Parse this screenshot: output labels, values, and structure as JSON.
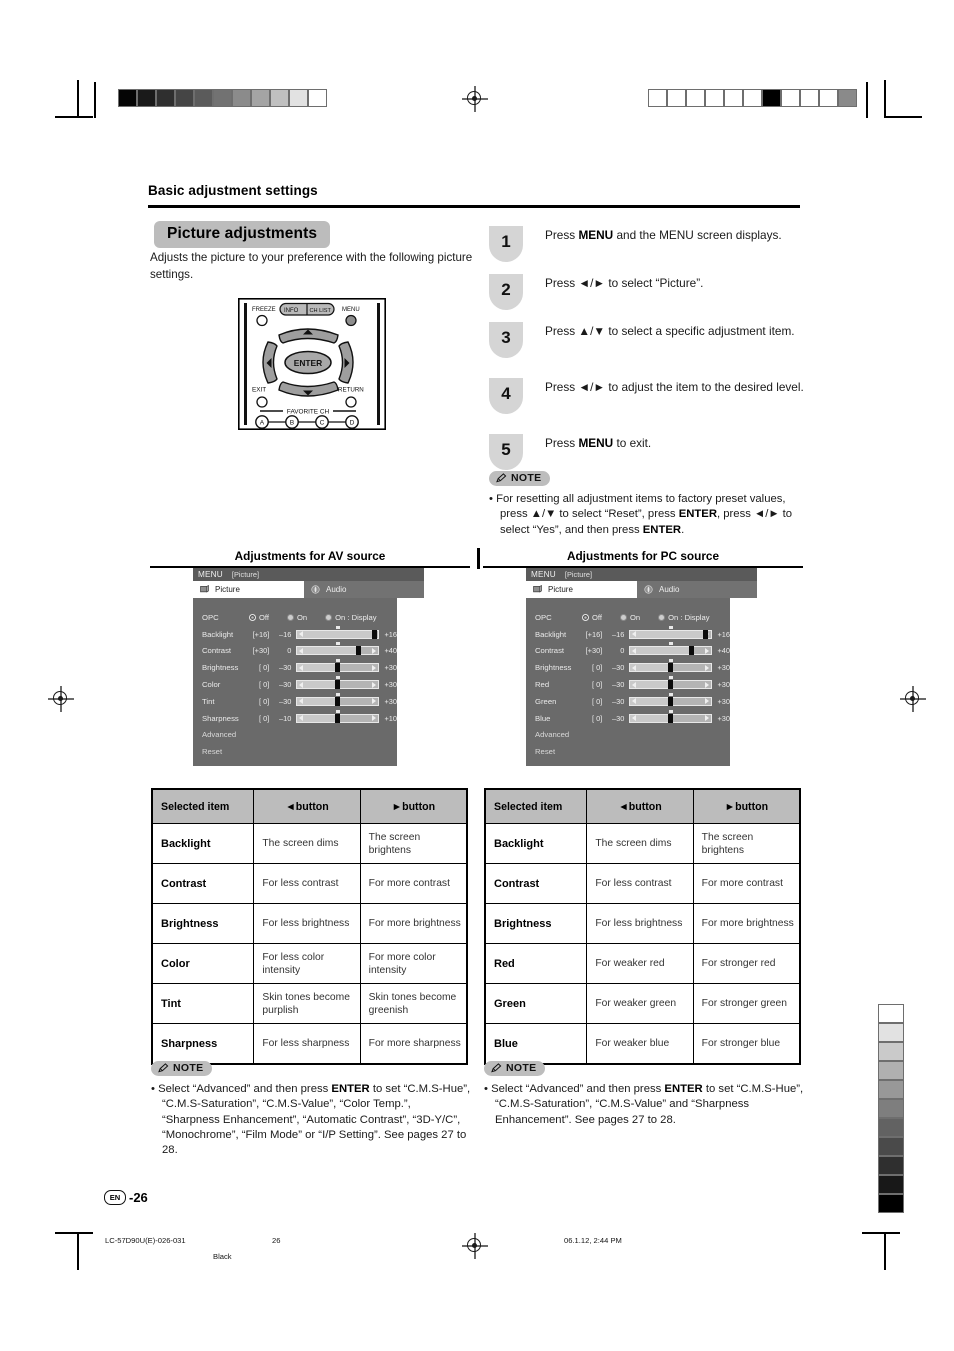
{
  "document": {
    "section_title": "Basic adjustment settings",
    "heading_chip": "Picture adjustments",
    "intro": "Adjusts the picture to your preference with the following picture settings."
  },
  "remote": {
    "labels": {
      "freeze": "FREEZE",
      "info": "INFO",
      "chlist": "CH LIST",
      "menu": "MENU",
      "enter": "ENTER",
      "exit": "EXIT",
      "return": "RETURN",
      "favorite": "FAVORITE CH",
      "a": "A",
      "b": "B",
      "c": "C",
      "d": "D"
    }
  },
  "steps": [
    {
      "n": "1",
      "html": "Press <b>MENU</b> and the MENU screen displays."
    },
    {
      "n": "2",
      "html": "Press ◄/► to select “Picture”."
    },
    {
      "n": "3",
      "html": "Press ▲/▼ to select a specific adjustment item."
    },
    {
      "n": "4",
      "html": "Press ◄/► to adjust the item to the desired level."
    },
    {
      "n": "5",
      "html": "Press <b>MENU</b> to exit."
    }
  ],
  "note_top": {
    "tag": "NOTE",
    "html": "• For resetting all adjustment items to factory preset values, press ▲/▼ to select “Reset”, press <b>ENTER</b>, press ◄/► to select “Yes”, and then press <b>ENTER</b>."
  },
  "av": {
    "subhead": "Adjustments for AV source",
    "osd": {
      "menu_label": "MENU",
      "picture_tag": "[Picture]",
      "tab_picture": "Picture",
      "tab_audio": "Audio",
      "opc_label": "OPC",
      "opc_options": [
        "Off",
        "On",
        "On : Display"
      ],
      "opc_selected": "Off",
      "rows": [
        {
          "label": "Backlight",
          "bracket": "[+16]",
          "min": "–16",
          "max": "+16",
          "pos": 95,
          "fillpct": 95
        },
        {
          "label": "Contrast",
          "bracket": "[+30]",
          "min": "0",
          "max": "+40",
          "pos": 75,
          "fillpct": 75
        },
        {
          "label": "Brightness",
          "bracket": "[  0]",
          "min": "–30",
          "max": "+30",
          "pos": 50,
          "fillpct": 50
        },
        {
          "label": "Color",
          "bracket": "[  0]",
          "min": "–30",
          "max": "+30",
          "pos": 50,
          "fillpct": 50
        },
        {
          "label": "Tint",
          "bracket": "[  0]",
          "min": "–30",
          "max": "+30",
          "pos": 50,
          "fillpct": 50
        },
        {
          "label": "Sharpness",
          "bracket": "[  0]",
          "min": "–10",
          "max": "+10",
          "pos": 50,
          "fillpct": 50
        }
      ],
      "advanced": "Advanced",
      "reset": "Reset"
    },
    "table": {
      "headers": [
        "Selected item",
        "◄button",
        "►button"
      ],
      "rows": [
        {
          "item": "Backlight",
          "left": "The screen dims",
          "right": "The screen brightens"
        },
        {
          "item": "Contrast",
          "left": "For less contrast",
          "right": "For more contrast"
        },
        {
          "item": "Brightness",
          "left": "For less brightness",
          "right": "For more brightness"
        },
        {
          "item": "Color",
          "left": "For less color intensity",
          "right": "For more color intensity"
        },
        {
          "item": "Tint",
          "left": "Skin tones become purplish",
          "right": "Skin tones become greenish"
        },
        {
          "item": "Sharpness",
          "left": "For less sharpness",
          "right": "For more sharpness"
        }
      ]
    },
    "note": {
      "tag": "NOTE",
      "html": "• Select “Advanced” and then press <b>ENTER</b> to set “C.M.S-Hue”, “C.M.S-Saturation”, “C.M.S-Value”, “Color Temp.”, “Sharpness Enhancement”, “Automatic Contrast”, “3D-Y/C”, “Monochrome”, “Film Mode” or “I/P Setting”. See pages 27 to 28."
    }
  },
  "pc": {
    "subhead": "Adjustments for PC source",
    "osd": {
      "menu_label": "MENU",
      "picture_tag": "[Picture]",
      "tab_picture": "Picture",
      "tab_audio": "Audio",
      "opc_label": "OPC",
      "opc_options": [
        "Off",
        "On",
        "On : Display"
      ],
      "opc_selected": "Off",
      "rows": [
        {
          "label": "Backlight",
          "bracket": "[+16]",
          "min": "–16",
          "max": "+16",
          "pos": 93,
          "fillpct": 93
        },
        {
          "label": "Contrast",
          "bracket": "[+30]",
          "min": "0",
          "max": "+40",
          "pos": 75,
          "fillpct": 75
        },
        {
          "label": "Brightness",
          "bracket": "[  0]",
          "min": "–30",
          "max": "+30",
          "pos": 50,
          "fillpct": 50
        },
        {
          "label": "Red",
          "bracket": "[  0]",
          "min": "–30",
          "max": "+30",
          "pos": 50,
          "fillpct": 50
        },
        {
          "label": "Green",
          "bracket": "[  0]",
          "min": "–30",
          "max": "+30",
          "pos": 50,
          "fillpct": 50
        },
        {
          "label": "Blue",
          "bracket": "[  0]",
          "min": "–30",
          "max": "+30",
          "pos": 50,
          "fillpct": 50
        }
      ],
      "advanced": "Advanced",
      "reset": "Reset"
    },
    "table": {
      "headers": [
        "Selected item",
        "◄button",
        "►button"
      ],
      "rows": [
        {
          "item": "Backlight",
          "left": "The screen dims",
          "right": "The screen brightens"
        },
        {
          "item": "Contrast",
          "left": "For less contrast",
          "right": "For more contrast"
        },
        {
          "item": "Brightness",
          "left": "For less brightness",
          "right": "For more brightness"
        },
        {
          "item": "Red",
          "left": "For weaker red",
          "right": "For stronger red"
        },
        {
          "item": "Green",
          "left": "For weaker green",
          "right": "For stronger green"
        },
        {
          "item": "Blue",
          "left": "For weaker blue",
          "right": "For stronger blue"
        }
      ]
    },
    "note": {
      "tag": "NOTE",
      "html": "• Select “Advanced” and then press <b>ENTER</b> to set “C.M.S-Hue”, “C.M.S-Saturation”, “C.M.S-Value” and “Sharpness Enhancement”. See pages 27 to 28."
    }
  },
  "footer": {
    "lang_badge": "EN",
    "page_number": "-26",
    "file_id": "LC-57D90U(E)-026-031",
    "page_plain": "26",
    "plate": "Black",
    "timestamp": "06.1.12, 2:44 PM"
  },
  "print_marks": {
    "top_left_wedge": [
      "#050505",
      "#1a1a1a",
      "#2f2f2f",
      "#454545",
      "#5b5b5b",
      "#727272",
      "#8b8b8b",
      "#a4a4a4",
      "#c0c0c0",
      "#e2e2e2",
      "#ffffff"
    ],
    "top_right_wedge": [
      "#ffffff",
      "#ffffff",
      "#ffffff",
      "#ffffff",
      "#ffffff",
      "#ffffff",
      "#000000",
      "#ffffff",
      "#ffffff",
      "#ffffff",
      "#8a8a8a"
    ],
    "right_wedge": [
      "#ffffff",
      "#e2e2e2",
      "#cacaca",
      "#b0b0b0",
      "#989898",
      "#7e7e7e",
      "#626262",
      "#4a4a4a",
      "#2f2f2f",
      "#181818",
      "#000000"
    ]
  }
}
